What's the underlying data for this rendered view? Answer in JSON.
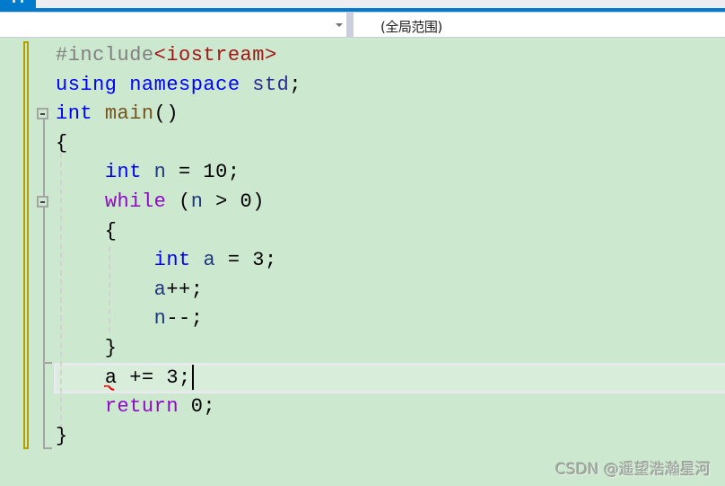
{
  "tabstrip": {
    "active_tab_icon": "pinned-tab-icon"
  },
  "navbar": {
    "left_dropdown_value": "",
    "right_dropdown_value": "(全局范围)",
    "dropdown_arrow_icon": "chevron-down-icon"
  },
  "editor": {
    "lines": [
      {
        "tokens": [
          {
            "t": "#include",
            "c": "pp"
          },
          {
            "t": "<iostream>",
            "c": "str"
          }
        ]
      },
      {
        "tokens": [
          {
            "t": "using",
            "c": "kw"
          },
          {
            "t": " ",
            "c": ""
          },
          {
            "t": "namespace",
            "c": "kw"
          },
          {
            "t": " ",
            "c": ""
          },
          {
            "t": "std",
            "c": "ns"
          },
          {
            "t": ";",
            "c": ""
          }
        ]
      },
      {
        "tokens": [
          {
            "t": "int",
            "c": "kw"
          },
          {
            "t": " ",
            "c": ""
          },
          {
            "t": "main",
            "c": "fn"
          },
          {
            "t": "()",
            "c": ""
          }
        ]
      },
      {
        "tokens": [
          {
            "t": "{",
            "c": ""
          }
        ]
      },
      {
        "tokens": [
          {
            "t": "    ",
            "c": ""
          },
          {
            "t": "int",
            "c": "kw"
          },
          {
            "t": " ",
            "c": ""
          },
          {
            "t": "n",
            "c": "id"
          },
          {
            "t": " = 10;",
            "c": ""
          }
        ]
      },
      {
        "tokens": [
          {
            "t": "    ",
            "c": ""
          },
          {
            "t": "while",
            "c": "kw2"
          },
          {
            "t": " (",
            "c": ""
          },
          {
            "t": "n",
            "c": "id"
          },
          {
            "t": " > 0)",
            "c": ""
          }
        ]
      },
      {
        "tokens": [
          {
            "t": "    {",
            "c": ""
          }
        ]
      },
      {
        "tokens": [
          {
            "t": "        ",
            "c": ""
          },
          {
            "t": "int",
            "c": "kw"
          },
          {
            "t": " ",
            "c": ""
          },
          {
            "t": "a",
            "c": "id"
          },
          {
            "t": " = 3;",
            "c": ""
          }
        ]
      },
      {
        "tokens": [
          {
            "t": "        ",
            "c": ""
          },
          {
            "t": "a",
            "c": "id"
          },
          {
            "t": "++;",
            "c": ""
          }
        ]
      },
      {
        "tokens": [
          {
            "t": "        ",
            "c": ""
          },
          {
            "t": "n",
            "c": "id"
          },
          {
            "t": "--;",
            "c": ""
          }
        ]
      },
      {
        "tokens": [
          {
            "t": "    }",
            "c": ""
          }
        ]
      },
      {
        "tokens": [
          {
            "t": "    ",
            "c": ""
          },
          {
            "t": "a",
            "c": ""
          },
          {
            "t": " += 3;",
            "c": ""
          }
        ],
        "current": true,
        "error_token": "a"
      },
      {
        "tokens": [
          {
            "t": "    ",
            "c": ""
          },
          {
            "t": "return",
            "c": "kw2"
          },
          {
            "t": " 0;",
            "c": ""
          }
        ]
      },
      {
        "tokens": [
          {
            "t": "}",
            "c": ""
          }
        ]
      }
    ]
  },
  "watermark": "CSDN @遥望浩瀚星河",
  "colors": {
    "accent": "#007acc",
    "editor_bg": "#cce8cf",
    "keyword": "#0000ff",
    "control_keyword": "#8f08c4",
    "string": "#a31515",
    "preprocessor": "#808080",
    "error_squiggle": "#ff0000",
    "change_marker": "#b39e00"
  }
}
